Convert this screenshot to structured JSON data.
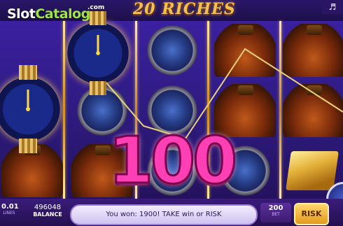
{
  "header": {
    "brand_part1": "Slot",
    "brand_part2": "Catalog",
    "brand_domain": ".com",
    "game_title": "20 RICHES",
    "sound_icon": "speaker-icon"
  },
  "reels": {
    "columns": [
      [
        "watch",
        "watch",
        "bottle"
      ],
      [
        "watch",
        "watch",
        "bottle"
      ],
      [
        "watch",
        "watch",
        "watch"
      ],
      [
        "bottle",
        "bottle",
        "watch"
      ],
      [
        "bottle",
        "bottle",
        "gold"
      ]
    ]
  },
  "win": {
    "amount": "100"
  },
  "bottom": {
    "lines_value": "0.01",
    "lines_label": "LINES",
    "balance_value": "496048",
    "balance_label": "BALANCE",
    "message": "You won: 1900! TAKE win or RISK",
    "bet_value": "200",
    "bet_label": "BET",
    "risk_label": "RISK"
  },
  "colors": {
    "win_text": "#ff3fb4",
    "gold_frame": "#f2c24a",
    "background": "#2a1466",
    "winline": "#e9d27a"
  }
}
